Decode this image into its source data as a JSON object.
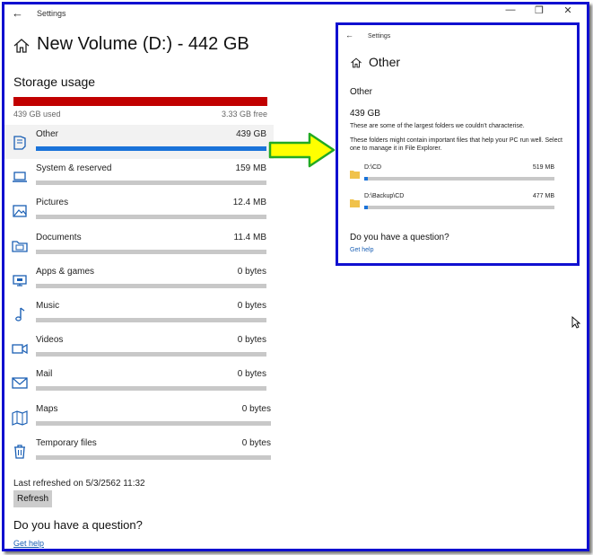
{
  "window": {
    "title": "Settings",
    "back_glyph": "←",
    "controls": [
      "—",
      "❐",
      "✕"
    ]
  },
  "page": {
    "title": "New Volume (D:) - 442 GB",
    "section_heading": "Storage usage",
    "used_label": "439 GB used",
    "free_label": "3.33 GB free",
    "used_fraction": 0.993,
    "bar_color": "#c10000"
  },
  "categories": [
    {
      "name": "Other",
      "size": "439 GB",
      "fraction": 1.0,
      "icon": "other-icon"
    },
    {
      "name": "System & reserved",
      "size": "159 MB",
      "fraction": 0.0,
      "icon": "laptop-icon"
    },
    {
      "name": "Pictures",
      "size": "12.4 MB",
      "fraction": 0.0,
      "icon": "picture-icon"
    },
    {
      "name": "Documents",
      "size": "11.4 MB",
      "fraction": 0.0,
      "icon": "documents-folder-icon"
    },
    {
      "name": "Apps & games",
      "size": "0 bytes",
      "fraction": 0.0,
      "icon": "apps-icon"
    },
    {
      "name": "Music",
      "size": "0 bytes",
      "fraction": 0.0,
      "icon": "music-note-icon"
    },
    {
      "name": "Videos",
      "size": "0 bytes",
      "fraction": 0.0,
      "icon": "video-camera-icon"
    },
    {
      "name": "Mail",
      "size": "0 bytes",
      "fraction": 0.0,
      "icon": "mail-icon"
    },
    {
      "name": "Maps",
      "size": "0 bytes",
      "fraction": 0.0,
      "icon": "map-icon"
    },
    {
      "name": "Temporary files",
      "size": "0 bytes",
      "fraction": 0.0,
      "icon": "trash-icon"
    }
  ],
  "footer": {
    "last_refreshed": "Last refreshed on 5/3/2562 11:32",
    "refresh_label": "Refresh",
    "question_heading": "Do you have a question?",
    "get_help": "Get help"
  },
  "inset": {
    "title": "Settings",
    "back_glyph": "←",
    "page_title": "Other",
    "heading": "Other",
    "total": "439 GB",
    "desc1": "These are some of the largest folders we couldn't characterise.",
    "desc2": "These folders might contain important files that help your PC run well. Select one to manage it in File Explorer.",
    "folders": [
      {
        "name": "D:\\CD",
        "size": "519 MB",
        "fraction": 0.02
      },
      {
        "name": "D:\\Backup\\CD",
        "size": "477 MB",
        "fraction": 0.02
      }
    ],
    "question_heading": "Do you have a question?",
    "get_help": "Get help"
  },
  "colors": {
    "accent_blue": "#1a73d9",
    "frame_blue": "#1010d0",
    "arrow_fill": "#ffff00",
    "arrow_stroke": "#22aa22",
    "link": "#1a5fb4"
  }
}
